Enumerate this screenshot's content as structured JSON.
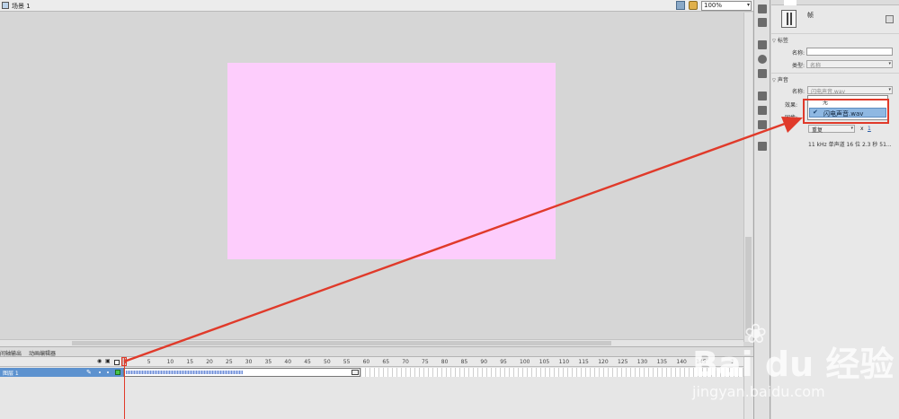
{
  "scene_bar": {
    "scene_label": "场景 1",
    "zoom_value": "100%"
  },
  "properties": {
    "frame_title": "帧",
    "label_section": "标签",
    "name_label": "名称:",
    "type_label": "类型:",
    "type_value": "名称",
    "sound_section": "声音",
    "sound_name_label": "名称:",
    "sound_name_value": "闪电声音.wav",
    "effect_label": "效果:",
    "sync_label": "同步:",
    "repeat_value": "重复",
    "repeat_x": "x",
    "repeat_count": "1",
    "sound_info": "11 kHz 单声道 16 位 2.3 秒 51..."
  },
  "sound_dropdown": {
    "none_option": "无",
    "wav_option": "闪电声音.wav",
    "check": "✔"
  },
  "timeline": {
    "tabs": [
      "时间轴",
      "输出",
      "动画编辑器"
    ],
    "layer_name": "图层 1",
    "ticks": [
      "1",
      "5",
      "10",
      "15",
      "20",
      "25",
      "30",
      "35",
      "40",
      "45",
      "50",
      "55",
      "60",
      "65",
      "70",
      "75",
      "80",
      "85",
      "90",
      "95",
      "100",
      "105",
      "110",
      "115",
      "120",
      "125",
      "130",
      "135",
      "140",
      "145",
      "1"
    ]
  },
  "watermark": {
    "brand": "Bai du 经验",
    "url": "jingyan.baidu.com",
    "paws": "❀"
  },
  "colors": {
    "stage": "#fdcdfc",
    "annotation_red": "#e03a2a",
    "layer_selected": "#5d92cf",
    "dropdown_selected": "#8fb8e2"
  }
}
